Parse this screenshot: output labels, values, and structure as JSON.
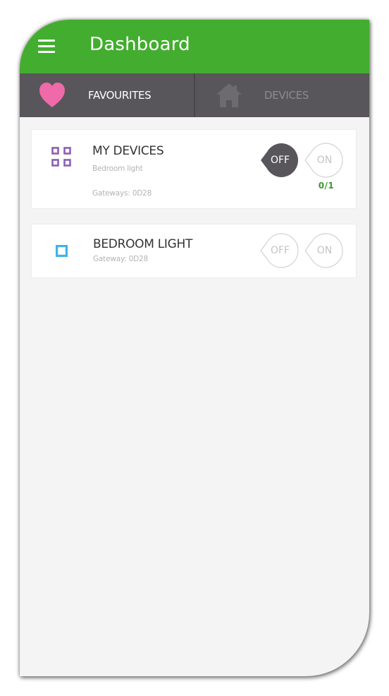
{
  "appbar": {
    "title": "Dashboard",
    "menu_icon": "hamburger-menu-icon",
    "color": "#43ad2f"
  },
  "tabs": [
    {
      "label": "FAVOURITES",
      "icon": "heart-icon",
      "active": true
    },
    {
      "label": "DEVICES",
      "icon": "home-icon",
      "active": false
    }
  ],
  "groups": [
    {
      "title": "MY DEVICES",
      "subtitle": "Bedroom light",
      "gateways": "Gateways: 0D28",
      "icon": "grid-icon",
      "off_label": "OFF",
      "on_label": "ON",
      "state": "off",
      "count": "0/1"
    }
  ],
  "devices": [
    {
      "title": "BEDROOM LIGHT",
      "gateway": "Gateway: 0D28",
      "icon": "light-square-icon",
      "off_label": "OFF",
      "on_label": "ON",
      "state": "unknown"
    }
  ],
  "colors": {
    "accent": "#43ad2f",
    "tabbar": "#58565a",
    "heart": "#ef6aa8",
    "group_icon": "#8c5eb6",
    "device_icon": "#3fb4e6",
    "toggle_active": "#58565a"
  }
}
